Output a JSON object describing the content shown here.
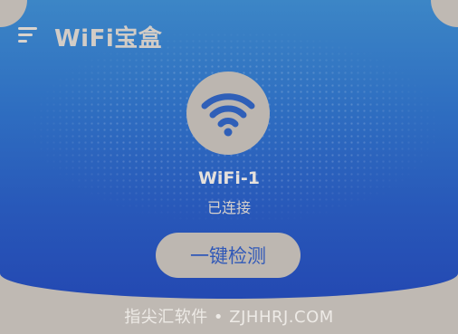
{
  "header": {
    "menu_icon": "menu-lines-icon",
    "title": "WiFi宝盒"
  },
  "connection": {
    "icon": "wifi-icon",
    "ssid": "WiFi-1",
    "status": "已连接"
  },
  "actions": {
    "scan_label": "一键检测"
  },
  "watermark": {
    "text": "指尖汇软件 • ZJHHRJ.COM"
  },
  "colors": {
    "gradient_top": "#3c86c6",
    "gradient_bottom": "#2449b2",
    "accent_text": "#3058b8",
    "panel_neutral": "#bfb9b3"
  }
}
